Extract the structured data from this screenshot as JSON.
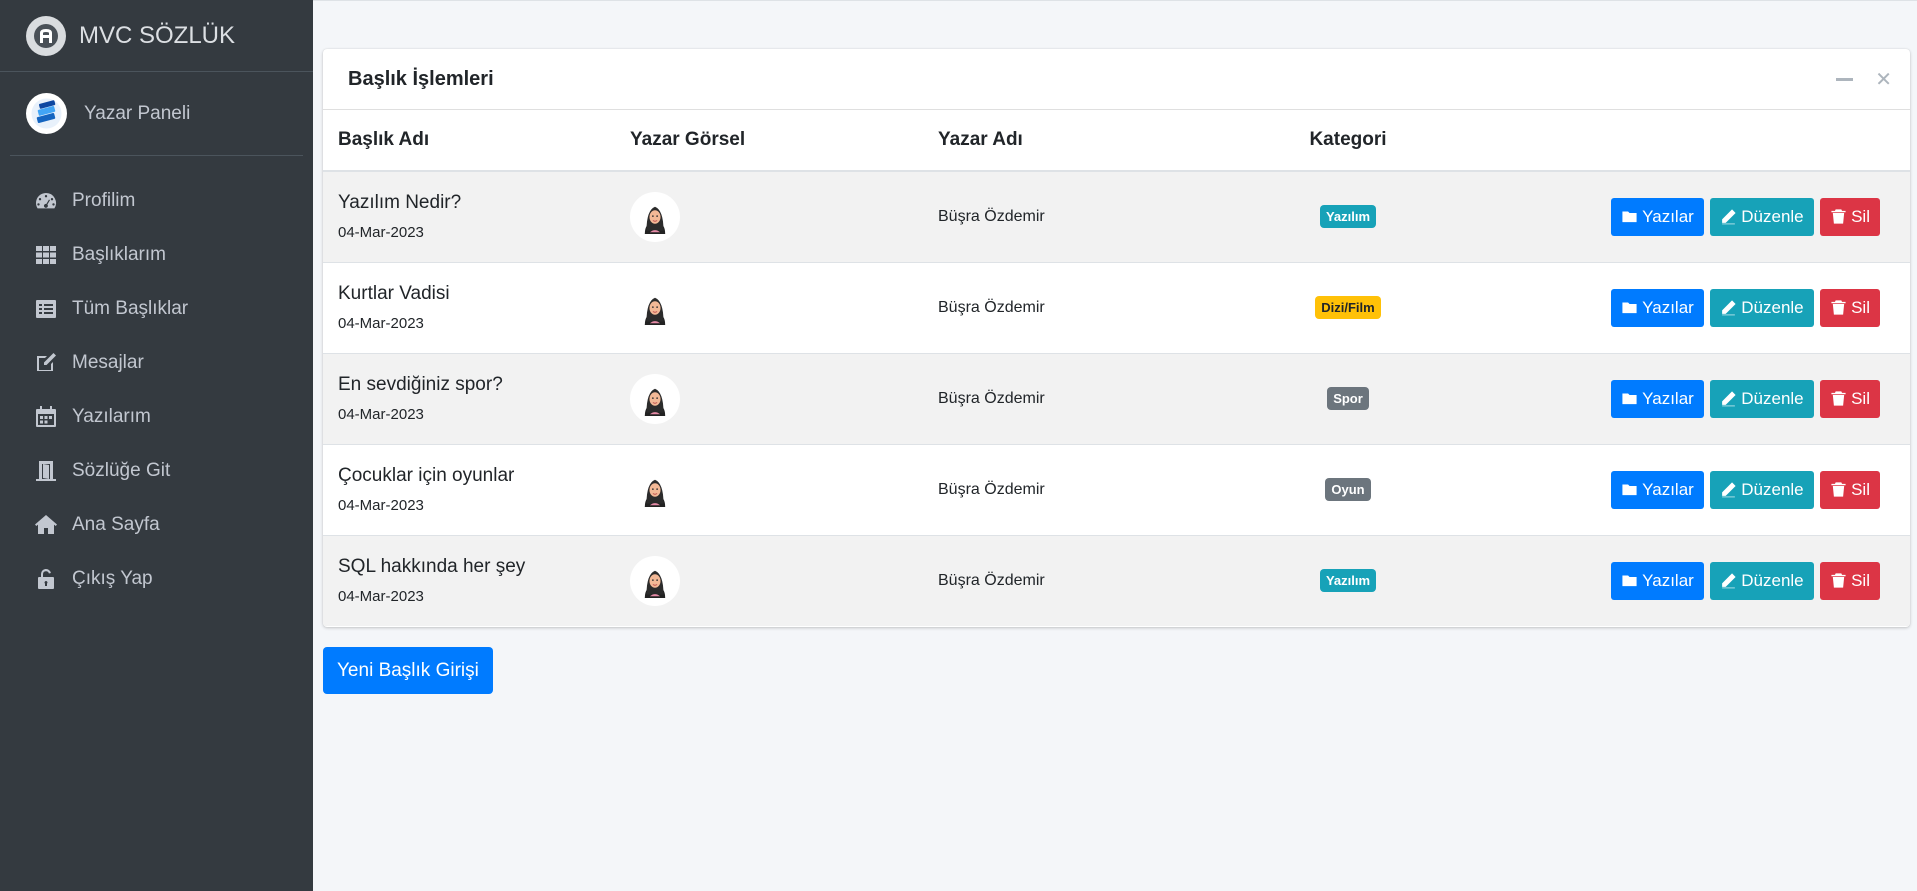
{
  "brand": {
    "name": "MVC SÖZLÜK"
  },
  "user_panel": {
    "name": "Yazar Paneli"
  },
  "sidebar": {
    "items": [
      {
        "label": "Profilim",
        "icon": "tachometer-icon"
      },
      {
        "label": "Başlıklarım",
        "icon": "grid-icon"
      },
      {
        "label": "Tüm Başlıklar",
        "icon": "list-icon"
      },
      {
        "label": "Mesajlar",
        "icon": "edit-icon"
      },
      {
        "label": "Yazılarım",
        "icon": "calendar-icon"
      },
      {
        "label": "Sözlüğe Git",
        "icon": "door-icon"
      },
      {
        "label": "Ana Sayfa",
        "icon": "home-icon"
      },
      {
        "label": "Çıkış Yap",
        "icon": "unlock-icon"
      }
    ]
  },
  "card": {
    "title": "Başlık İşlemleri",
    "columns": [
      "Başlık Adı",
      "Yazar Görsel",
      "Yazar Adı",
      "Kategori"
    ],
    "rows": [
      {
        "title": "Yazılım Nedir?",
        "date": "04-Mar-2023",
        "author": "Büşra Özdemir",
        "category": "Yazılım",
        "category_color": "#17a2b8",
        "avatar_bg": true
      },
      {
        "title": "Kurtlar Vadisi",
        "date": "04-Mar-2023",
        "author": "Büşra Özdemir",
        "category": "Dizi/Film",
        "category_color": "#ffc107",
        "avatar_bg": false
      },
      {
        "title": "En sevdiğiniz spor?",
        "date": "04-Mar-2023",
        "author": "Büşra Özdemir",
        "category": "Spor",
        "category_color": "#6c757d",
        "avatar_bg": true
      },
      {
        "title": "Çocuklar için oyunlar",
        "date": "04-Mar-2023",
        "author": "Büşra Özdemir",
        "category": "Oyun",
        "category_color": "#6c757d",
        "avatar_bg": false
      },
      {
        "title": "SQL hakkında her şey",
        "date": "04-Mar-2023",
        "author": "Büşra Özdemir",
        "category": "Yazılım",
        "category_color": "#17a2b8",
        "avatar_bg": true
      }
    ],
    "actions": {
      "posts": "Yazılar",
      "edit": "Düzenle",
      "delete": "Sil"
    }
  },
  "new_button": {
    "label": "Yeni Başlık Girişi"
  },
  "colors": {
    "sidebar": "#343a40",
    "primary": "#007bff",
    "info": "#17a2b8",
    "danger": "#dc3545",
    "warning": "#ffc107",
    "secondary": "#6c757d"
  }
}
